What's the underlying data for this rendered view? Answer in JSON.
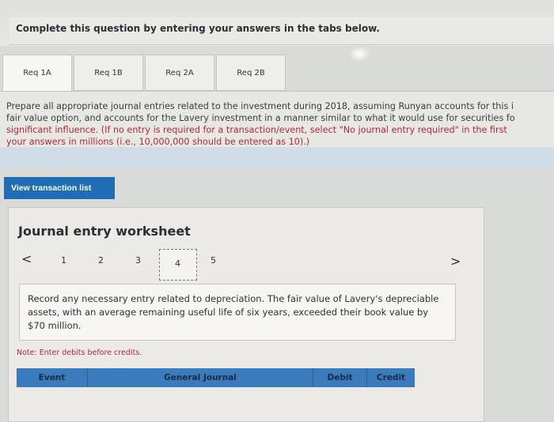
{
  "instruction": "Complete this question by entering your answers in the tabs below.",
  "tabs": [
    {
      "label": "Req 1A"
    },
    {
      "label": "Req 1B"
    },
    {
      "label": "Req 2A"
    },
    {
      "label": "Req 2B"
    }
  ],
  "question": {
    "lines": [
      "Prepare all appropriate journal entries related to the investment during 2018, assuming Runyan accounts for this i",
      "fair value option, and accounts for the Lavery investment in a manner similar to what it would use for securities fo",
      "significant influence. (If no entry is required for a transaction/event, select \"No journal entry required\" in the first",
      "your answers in millions (i.e., 10,000,000 should be entered as 10).)"
    ]
  },
  "view_transaction_list_label": "View transaction list",
  "worksheet": {
    "title": "Journal entry worksheet",
    "prev_glyph": "<",
    "next_glyph": ">",
    "pages": [
      "1",
      "2",
      "3",
      "4",
      "5"
    ],
    "active_page": "4",
    "description": "Record any necessary entry related to depreciation. The fair value of Lavery's depreciable assets, with an average remaining useful life of six years, exceeded their book value by $70 million.",
    "note": "Note: Enter debits before credits.",
    "columns": [
      "Event",
      "General Journal",
      "Debit",
      "Credit"
    ]
  }
}
